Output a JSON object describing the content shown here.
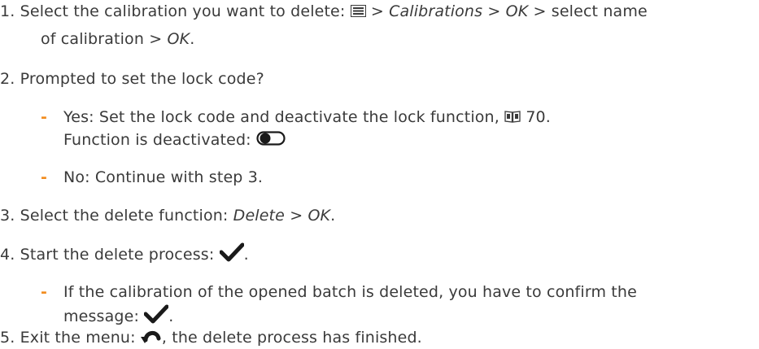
{
  "steps": {
    "s1": {
      "num": "1.",
      "t1": "Select the calibration you want to delete: ",
      "t2": " > ",
      "e1": "Calibrations",
      "t3": " > ",
      "e2": "OK",
      "t4": " > select name",
      "l2a": "of calibration > ",
      "l2e": "OK",
      "l2b": "."
    },
    "s2": {
      "num": "2.",
      "text": "Prompted to set the lock code?",
      "yes_a": "Yes: Set the lock code and deactivate the lock function, ",
      "yes_page": "70",
      "yes_b": ".",
      "yes_line2": "Function is deactivated: ",
      "no": "No: Continue with step 3."
    },
    "s3": {
      "num": "3.",
      "t1": "Select the delete function: ",
      "e1": "Delete",
      "t2": " > ",
      "e2": "OK",
      "t3": "."
    },
    "s4": {
      "num": "4.",
      "t1": "Start the delete process: ",
      "t2": ".",
      "sub_l1": "If the calibration of the opened batch is deleted, you have to confirm the",
      "sub_l2": "message: ",
      "sub_end": "."
    },
    "s5": {
      "num": "5.",
      "t1": "Exit the menu: ",
      "t2": ", the delete process has finished."
    }
  },
  "colors": {
    "text": "#3a3a3a",
    "bullet": "#f28c1e"
  },
  "icons": [
    "menu-icon",
    "manual-book-icon",
    "toggle-off-icon",
    "checkmark-icon",
    "back-arrow-icon"
  ]
}
